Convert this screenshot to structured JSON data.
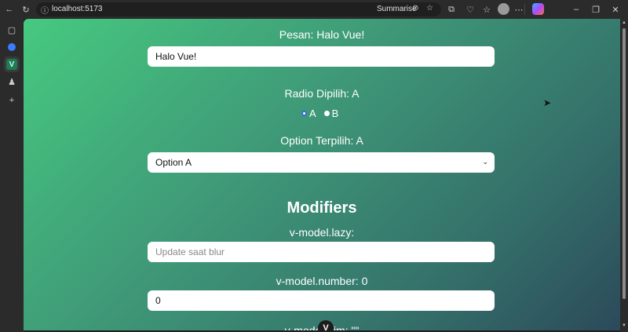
{
  "browser": {
    "url": "localhost:5173",
    "summarise_label": "Summarise",
    "icons": [
      "back-icon",
      "refresh-icon",
      "site-info-icon",
      "translate-icon",
      "favorite-icon",
      "extensions-icon",
      "browser-essentials-icon",
      "collections-icon",
      "profile-avatar",
      "more-icon",
      "copilot-icon",
      "minimize-icon",
      "restore-icon",
      "close-icon"
    ]
  },
  "sidebar": {
    "icons": [
      "tabs-icon",
      "copilot-sidebar-icon",
      "vue-app-icon",
      "app-icon",
      "add-icon"
    ]
  },
  "page": {
    "pesan_label": "Pesan: Halo Vue!",
    "pesan_value": "Halo Vue!",
    "radio_label": "Radio Dipilih: A",
    "radio_options": [
      "A",
      "B"
    ],
    "option_label": "Option Terpilih: A",
    "select_value": "Option A",
    "modifiers_heading": "Modifiers",
    "lazy_label": "v-model.lazy:",
    "lazy_placeholder": "Update saat blur",
    "number_label": "v-model.number: 0",
    "number_value": "0",
    "trim_label": "v-model.trim: \"\""
  },
  "colors": {
    "gradient_start": "#46c97f",
    "gradient_end": "#2c4a5a"
  }
}
